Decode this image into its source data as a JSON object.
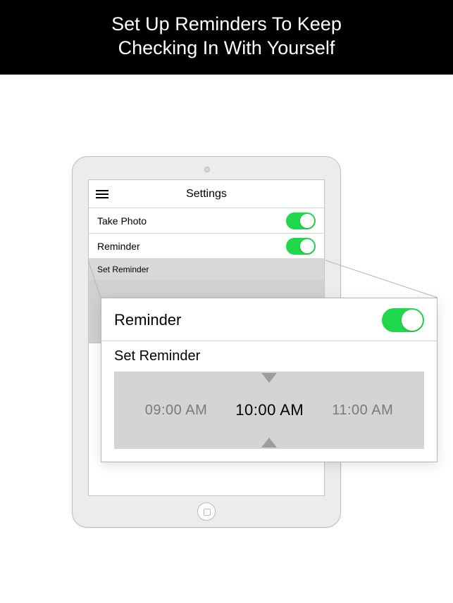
{
  "banner": {
    "line1": "Set Up Reminders To Keep",
    "line2": "Checking In With Yourself"
  },
  "tablet": {
    "nav_title": "Settings",
    "rows": [
      {
        "label": "Take Photo",
        "toggle_on": true
      },
      {
        "label": "Reminder",
        "toggle_on": true
      }
    ],
    "set_reminder_label": "Set Reminder"
  },
  "callout": {
    "reminder_label": "Reminder",
    "reminder_toggle_on": true,
    "set_reminder_label": "Set Reminder",
    "picker": {
      "prev": "09:00 AM",
      "selected": "10:00 AM",
      "next": "11:00 AM"
    }
  }
}
